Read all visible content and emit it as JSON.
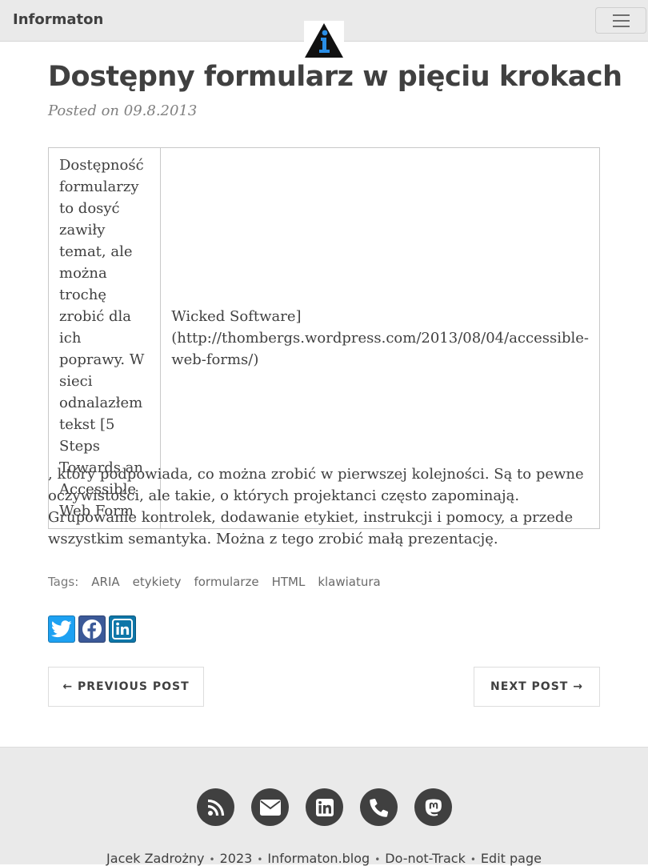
{
  "navbar": {
    "brand": "Informaton"
  },
  "post": {
    "title": "Dostępny formularz w pięciu krokach",
    "meta": "Posted on 09.8.2013",
    "table": {
      "cell1": "Dostępność formularzy to dosyć zawiły temat, ale można trochę zrobić dla ich poprawy. W sieci odnalazłem tekst [5 Steps Towards an Accessible Web Form",
      "cell2": "Wicked Software](http://thombergs.wordpress.com/2013/08/04/accessible-web-forms/)"
    },
    "body": ", który podpowiada, co można zrobić w pierwszej kolejności. Są to pewne oczywistości, ale takie, o których projektanci często zapominają. Grupowanie kontrolek, dodawanie etykiet, instrukcji i pomocy, a przede wszystkim semantyka. Można z tego zrobić małą prezentację."
  },
  "tags": {
    "label": "Tags:",
    "items": [
      "ARIA",
      "etykiety",
      "formularze",
      "HTML",
      "klawiatura"
    ]
  },
  "share": {
    "icons": [
      "twitter-icon",
      "facebook-icon",
      "linkedin-icon"
    ]
  },
  "pager": {
    "previous": "← PREVIOUS POST",
    "next": "NEXT POST →"
  },
  "footer": {
    "icons": [
      "rss-icon",
      "email-icon",
      "linkedin-icon",
      "phone-icon",
      "mastodon-icon"
    ],
    "author": "Jacek Zadrożny",
    "year": "2023",
    "site": "Informaton.blog",
    "dnt": "Do-not-Track",
    "edit": "Edit page"
  },
  "colors": {
    "navbar_bg": "#eaeaea",
    "text": "#404040",
    "twitter": "#1da1f2",
    "facebook": "#3b5998",
    "linkedin": "#0e76a8"
  }
}
